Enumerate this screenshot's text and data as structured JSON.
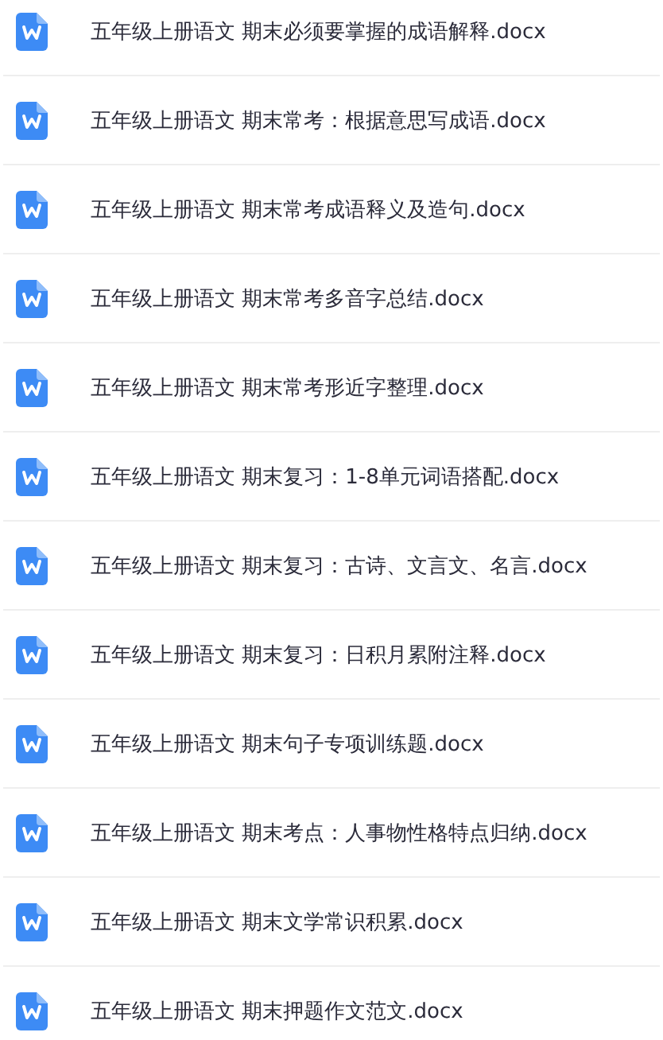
{
  "files": [
    {
      "name": "五年级上册语文 期末必须要掌握的成语解释.docx"
    },
    {
      "name": "五年级上册语文 期末常考：根据意思写成语.docx"
    },
    {
      "name": "五年级上册语文 期末常考成语释义及造句.docx"
    },
    {
      "name": "五年级上册语文 期末常考多音字总结.docx"
    },
    {
      "name": "五年级上册语文 期末常考形近字整理.docx"
    },
    {
      "name": "五年级上册语文 期末复习：1-8单元词语搭配.docx"
    },
    {
      "name": "五年级上册语文 期末复习：古诗、文言文、名言.docx"
    },
    {
      "name": "五年级上册语文 期末复习：日积月累附注释.docx"
    },
    {
      "name": "五年级上册语文 期末句子专项训练题.docx"
    },
    {
      "name": "五年级上册语文 期末考点：人事物性格特点归纳.docx"
    },
    {
      "name": "五年级上册语文 期末文学常识积累.docx"
    },
    {
      "name": "五年级上册语文 期末押题作文范文.docx"
    }
  ]
}
